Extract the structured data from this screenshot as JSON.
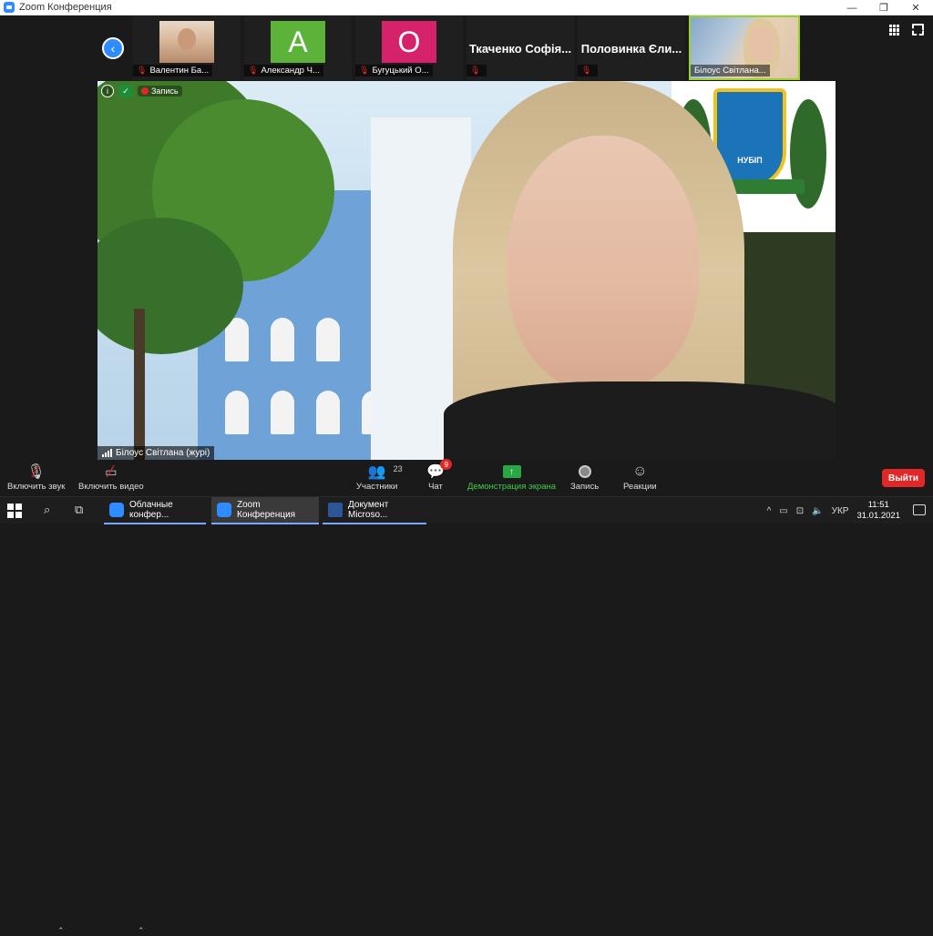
{
  "window": {
    "title": "Zoom Конференция",
    "controls": [
      "—",
      "❐",
      "✕"
    ]
  },
  "gallery_strip": {
    "participants": [
      {
        "name": "Валентин Ба...",
        "tile": "photo"
      },
      {
        "name": "Александр Ч...",
        "tile": "A",
        "color": "#5db33a"
      },
      {
        "name": "Бугуцький О...",
        "tile": "O",
        "color": "#d6226a"
      },
      {
        "name": "",
        "display": "Ткаченко Софія..."
      },
      {
        "name": "",
        "display": "Половинка Єли..."
      }
    ],
    "active_speaker": {
      "name": "Білоус Світлана..."
    }
  },
  "top_right_icons": [
    "grid-view-icon",
    "fullscreen-icon"
  ],
  "main_video": {
    "recording_label": "Запись",
    "speaker_label": "Білоус Світлана (журі)",
    "emblem_text": "НУБІП"
  },
  "toolbar": {
    "mute_label": "Включить звук",
    "video_label": "Включить видео",
    "participants_label": "Участники",
    "participants_count": "23",
    "chat_label": "Чат",
    "chat_badge": "9",
    "share_label": "Демонстрация экрана",
    "record_label": "Запись",
    "reactions_label": "Реакции",
    "leave_label": "Выйти",
    "accent_green": "#3ecf4a",
    "leave_color": "#e02828"
  },
  "taskbar": {
    "tasks": [
      {
        "label": "Облачные конфер..."
      },
      {
        "label": "Zoom Конференция"
      },
      {
        "label": "Документ Microso..."
      }
    ],
    "language": "УКР",
    "time": "11:51",
    "date": "31.01.2021"
  }
}
